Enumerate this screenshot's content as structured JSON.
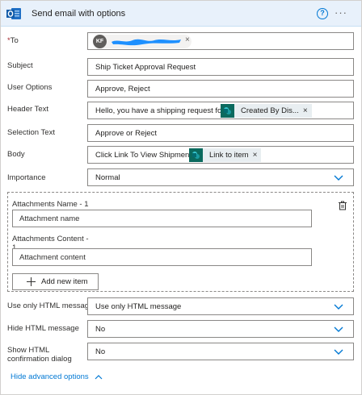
{
  "header": {
    "title": "Send email with options",
    "help_glyph": "?",
    "more_glyph": "···"
  },
  "fields": {
    "to": {
      "label": "To",
      "required_mark": "*",
      "avatar_initials": "KF"
    },
    "subject": {
      "label": "Subject",
      "value": "Ship Ticket Approval Request"
    },
    "user_options": {
      "label": "User Options",
      "value": "Approve, Reject"
    },
    "header_text": {
      "label": "Header Text",
      "value": "Hello, you have a shipping request for",
      "token_label": "Created By Dis..."
    },
    "selection_text": {
      "label": "Selection Text",
      "value": "Approve or Reject"
    },
    "body": {
      "label": "Body",
      "value": "Click Link To View Shipment",
      "token_label": "Link to item"
    },
    "importance": {
      "label": "Importance",
      "value": "Normal"
    }
  },
  "attachments": {
    "name_label": "Attachments Name - 1",
    "name_placeholder": "Attachment name",
    "content_label_line1": "Attachments Content -",
    "content_label_line2": "1",
    "content_placeholder": "Attachment content",
    "add_label": "Add new item"
  },
  "advanced": {
    "use_only_html": {
      "label": "Use only HTML message",
      "value": "Use only HTML message"
    },
    "hide_html": {
      "label": "Hide HTML message",
      "value": "No"
    },
    "show_html_confirmation": {
      "label_line1": "Show HTML",
      "label_line2": "confirmation dialog",
      "value": "No"
    },
    "toggle_label": "Hide advanced options"
  },
  "token_x_glyph": "×",
  "colors": {
    "accent": "#0078d4",
    "header_bg": "#e8f1fb",
    "token_bg": "#e8eef1",
    "sharepoint_icon": "#0b6a5e",
    "redaction": "#1e90ff"
  },
  "icons": {
    "outlook": "outlook-icon",
    "sharepoint": "sharepoint-icon",
    "delete": "delete-icon",
    "dropdown": "chevron-down-icon"
  }
}
